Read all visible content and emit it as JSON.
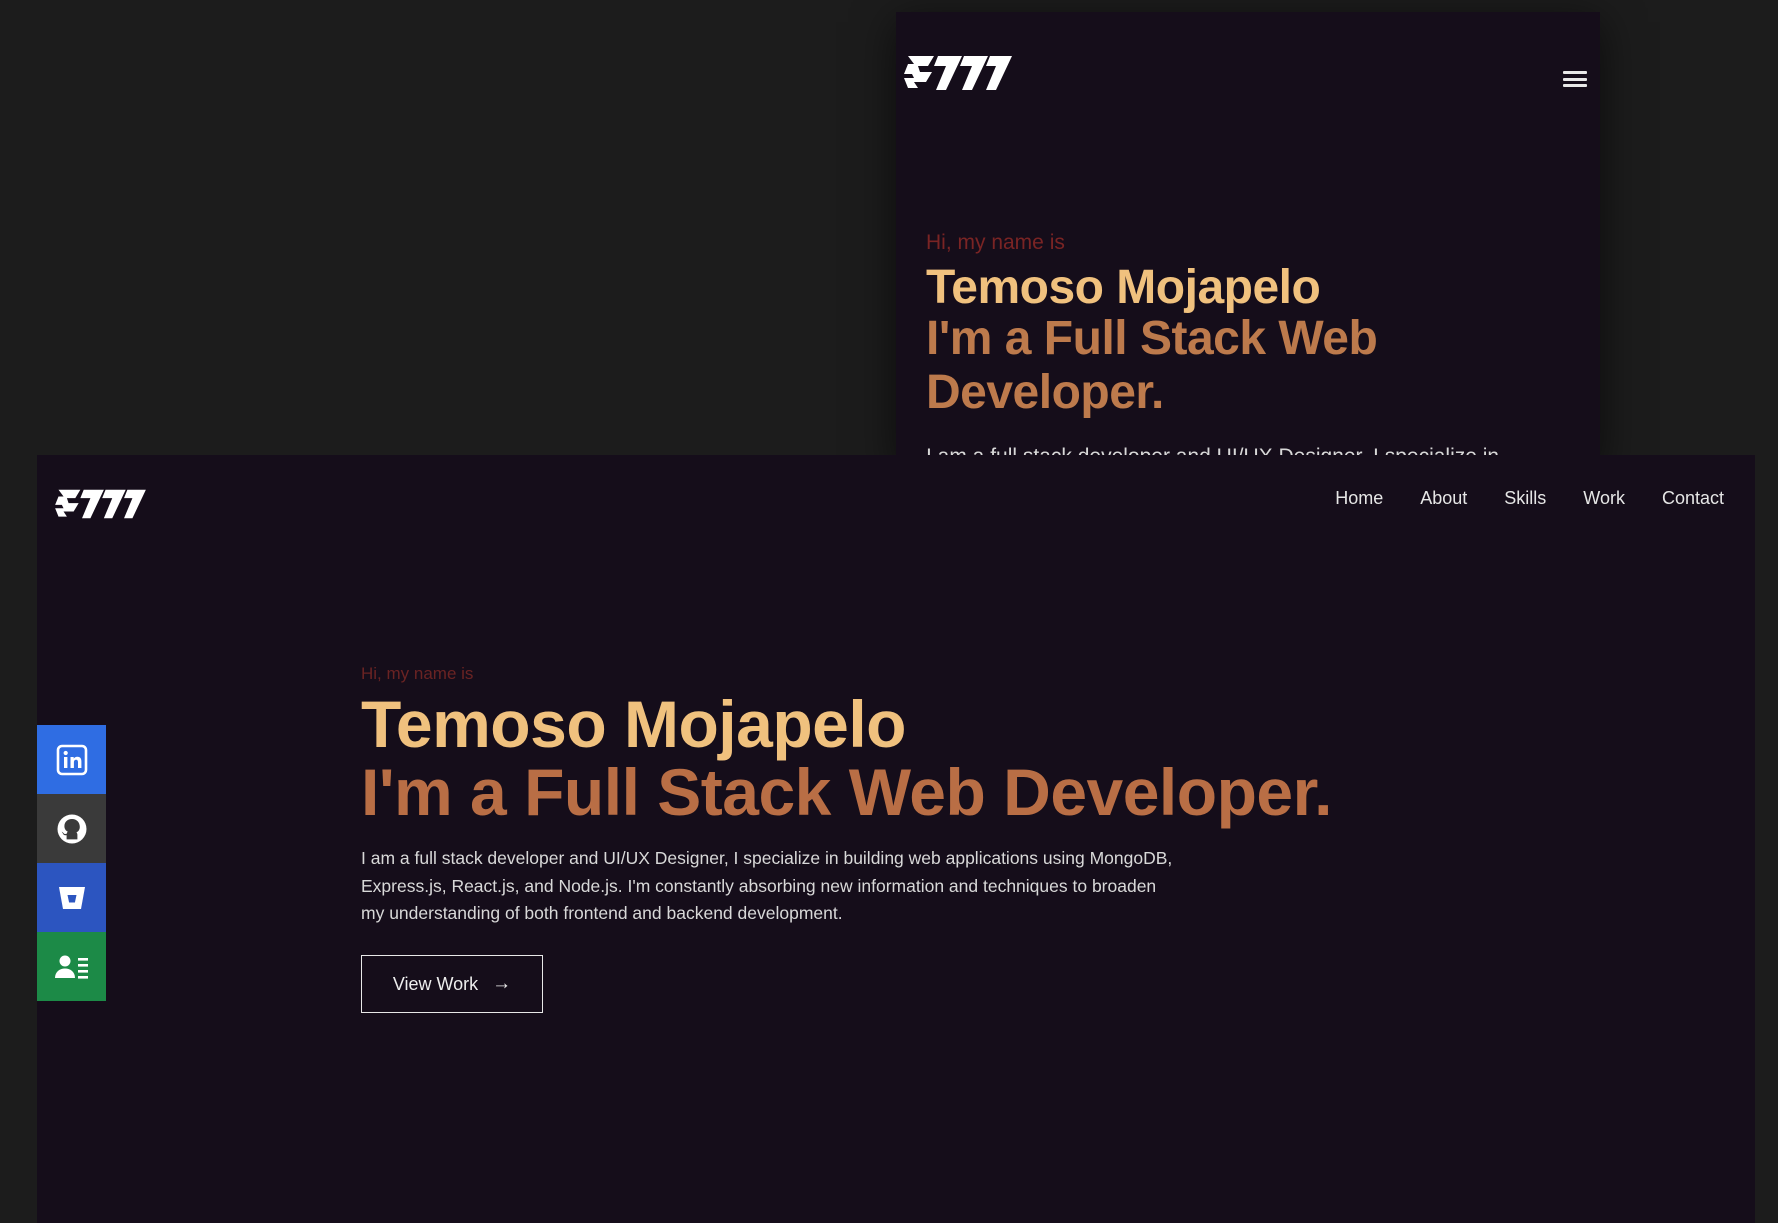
{
  "mobile": {
    "greeting": "Hi, my name is",
    "name": "Temoso Mojapelo",
    "role": "I'm a Full Stack Web Developer.",
    "description_partial": "I am a full stack developer and UI/UX Designer, I specialize in",
    "menu_icon": "hamburger-icon"
  },
  "desktop": {
    "nav": {
      "home": "Home",
      "about": "About",
      "skills": "Skills",
      "work": "Work",
      "contact": "Contact"
    },
    "hero": {
      "greeting": "Hi, my name is",
      "name": "Temoso Mojapelo",
      "role": "I'm a Full Stack Web Developer.",
      "description": "I am a full stack developer and UI/UX Designer, I specialize in building web applications using MongoDB, Express.js, React.js, and Node.js. I'm constantly absorbing new information and techniques to broaden my understanding of both frontend and backend development.",
      "cta": "View Work",
      "cta_icon": "arrow-right-icon"
    },
    "social": [
      "linkedin-icon",
      "github-icon",
      "bitbucket-icon",
      "resume-icon"
    ]
  },
  "colors": {
    "page_bg": "#1c1c1c",
    "site_bg": "#150d1a",
    "name": "#f0c17e",
    "role": "#b96e45",
    "greeting": "#6a2323",
    "linkedin": "#2f6de3",
    "github": "#3a3a3a",
    "bitbucket": "#2c55c0",
    "resume": "#1c8a47"
  }
}
